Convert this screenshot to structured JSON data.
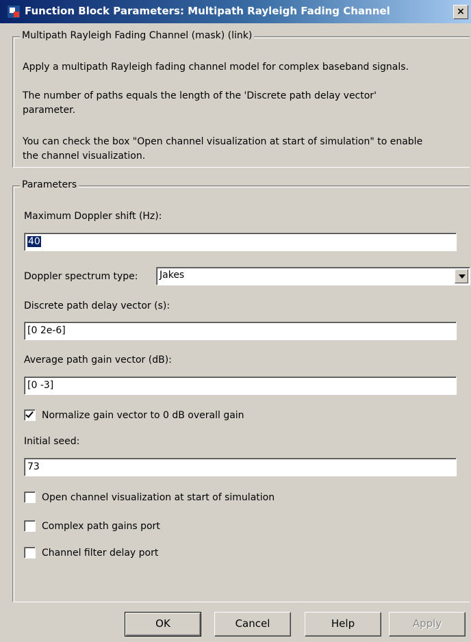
{
  "window": {
    "title": "Function Block Parameters: Multipath Rayleigh Fading Channel",
    "close_glyph": "×"
  },
  "description": {
    "group_label": "Multipath Rayleigh Fading Channel (mask) (link)",
    "lines": [
      "Apply a multipath Rayleigh fading channel model for complex baseband signals.",
      "The number of paths equals the length of the 'Discrete path delay vector'",
      "parameter.",
      "You can check the box \"Open channel visualization at start of simulation\" to enable",
      "the channel visualization."
    ]
  },
  "parameters": {
    "group_label": "Parameters",
    "max_doppler": {
      "label": "Maximum Doppler shift (Hz):",
      "value": "40"
    },
    "doppler_spectrum": {
      "label": "Doppler spectrum type:",
      "value": "Jakes"
    },
    "path_delay": {
      "label": "Discrete path delay vector (s):",
      "value": "[0 2e-6]"
    },
    "path_gain": {
      "label": "Average path gain vector (dB):",
      "value": "[0 -3]"
    },
    "normalize": {
      "label": "Normalize gain vector to 0 dB overall gain",
      "checked": true
    },
    "initial_seed": {
      "label": "Initial seed:",
      "value": "73"
    },
    "open_visualization": {
      "label": "Open channel visualization at start of simulation",
      "checked": false
    },
    "complex_gains_port": {
      "label": "Complex path gains port",
      "checked": false
    },
    "filter_delay_port": {
      "label": "Channel filter delay port",
      "checked": false
    }
  },
  "buttons": {
    "ok": "OK",
    "cancel": "Cancel",
    "help": "Help",
    "apply": "Apply"
  },
  "colors": {
    "title_bar_start": "#0a246a",
    "title_bar_end": "#a6caf0",
    "dialog_background": "#d4d0c8",
    "selection": "#0a246a"
  }
}
